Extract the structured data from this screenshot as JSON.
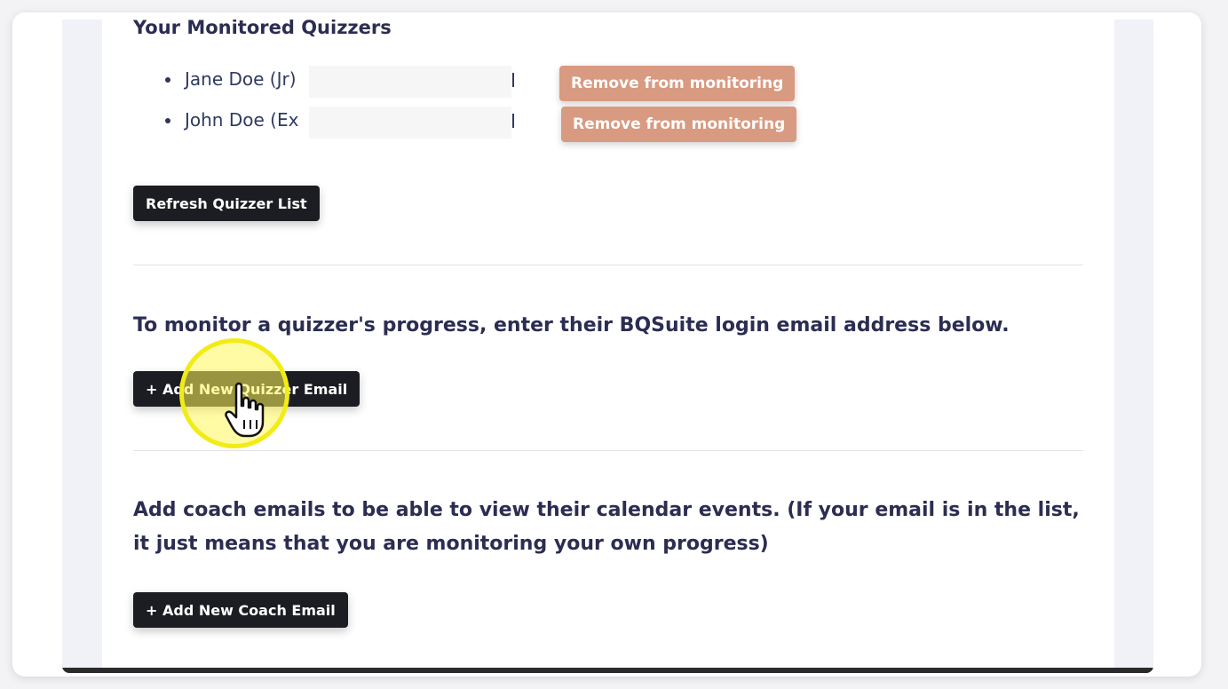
{
  "monitored": {
    "heading": "Your Monitored Quizzers",
    "quizzers": [
      {
        "name": "Jane Doe (Jr)",
        "remove_label": "Remove from monitoring"
      },
      {
        "name": "John Doe (Ex",
        "remove_label": "Remove from monitoring"
      }
    ],
    "refresh_label": "Refresh Quizzer List"
  },
  "add_quizzer": {
    "instruction": "To monitor a quizzer's progress, enter their BQSuite login email address below.",
    "button_label": "+ Add New Quizzer Email"
  },
  "add_coach": {
    "instruction": "Add coach emails to be able to view their calendar events. (If your email is in the list, it just means that you are monitoring your own progress)",
    "button_label": "+ Add New Coach Email"
  },
  "colors": {
    "remove_button": "#d89a80",
    "primary_button": "#1b1d22",
    "heading_text": "#2b2d52",
    "click_highlight": "#f2ec16"
  },
  "icons": {
    "cursor": "hand-pointer-icon"
  }
}
